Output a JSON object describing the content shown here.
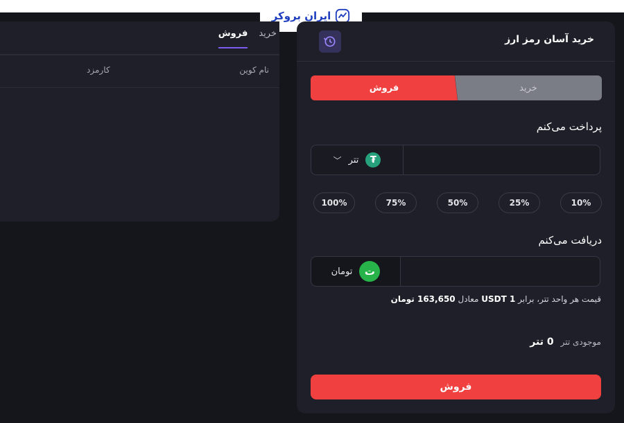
{
  "brand": {
    "name": "ایران بروکر"
  },
  "left_panel": {
    "tabs": [
      {
        "label": "خرید",
        "active": false
      },
      {
        "label": "فروش",
        "active": true
      }
    ],
    "columns": {
      "coin_name": "نام کوین",
      "fee": "کارمزد"
    }
  },
  "right_panel": {
    "title": "خرید آسان رمز ارز",
    "segments": {
      "buy": "خرید",
      "sell": "فروش",
      "active": "sell"
    },
    "pay": {
      "label": "پرداخت می‌کنم",
      "currency": "تتر",
      "value": ""
    },
    "percents": [
      "10%",
      "25%",
      "50%",
      "75%",
      "100%"
    ],
    "receive": {
      "label": "دریافت می‌کنم",
      "currency": "تومان",
      "value": ""
    },
    "price_info": {
      "prefix": "قیمت هر واحد تتر، برابر",
      "unit_amount": "1 USDT",
      "middle": "معادل",
      "price": "163,650 تومان"
    },
    "balance": {
      "label": "موجودی تتر",
      "value": "0 تتر"
    },
    "submit_label": "فروش"
  },
  "colors": {
    "accent_red": "#f0403f",
    "accent_purple": "#7c5cf0",
    "tether_green": "#26a17b",
    "toman_green": "#27b34a"
  },
  "icons": [
    "history-icon",
    "tether-icon",
    "toman-icon",
    "chevron-down-icon",
    "brand-chart-icon"
  ]
}
